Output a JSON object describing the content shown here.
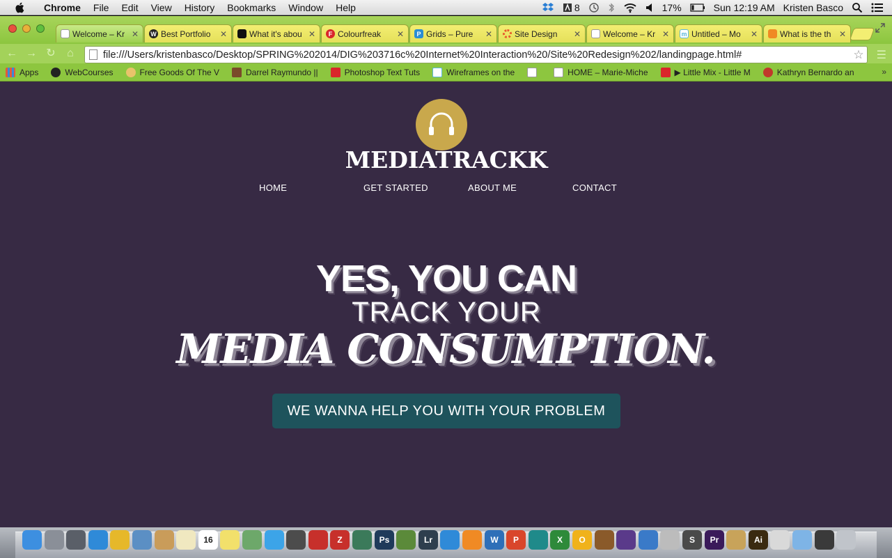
{
  "menubar": {
    "items": [
      "Chrome",
      "File",
      "Edit",
      "View",
      "History",
      "Bookmarks",
      "Window",
      "Help"
    ],
    "notification_count": "8",
    "battery": "17%",
    "clock": "Sun 12:19 AM",
    "user": "Kristen Basco"
  },
  "tabs": [
    {
      "title": "Welcome – Kr",
      "favicon": "page-icon",
      "color": "#ffffff"
    },
    {
      "title": "Best Portfolio",
      "favicon": "w-icon",
      "color": "#222222"
    },
    {
      "title": "What it's abou",
      "favicon": "film-icon",
      "color": "#111111"
    },
    {
      "title": "Colourfreak",
      "favicon": "f-icon",
      "color": "#d9262b"
    },
    {
      "title": "Grids – Pure",
      "favicon": "p-icon",
      "color": "#2a8dd4"
    },
    {
      "title": "Site Design",
      "favicon": "ring-icon",
      "color": "#e8582b"
    },
    {
      "title": "Welcome – Kr",
      "favicon": "page-icon",
      "color": "#ffffff"
    },
    {
      "title": "Untitled – Mo",
      "favicon": "m-icon",
      "color": "#5bb7db"
    },
    {
      "title": "What is the th",
      "favicon": "stack-icon",
      "color": "#f08a24"
    }
  ],
  "toolbar": {
    "url": "file:///Users/kristenbasco/Desktop/SPRING%202014/DIG%203716c%20Internet%20Interaction%20/Site%20Redesign%202/landingpage.html#"
  },
  "bookmarks": [
    {
      "label": "Apps",
      "color": "#e25b3a"
    },
    {
      "label": "WebCourses",
      "color": "#222222"
    },
    {
      "label": "Free Goods Of The V",
      "color": "#e9c36b"
    },
    {
      "label": "Darrel Raymundo ||",
      "color": "#7a4a2a"
    },
    {
      "label": "Photoshop Text Tuts",
      "color": "#d9262b"
    },
    {
      "label": "Wireframes on the",
      "color": "#5bb7db"
    },
    {
      "label": "",
      "color": "#ffffff"
    },
    {
      "label": "HOME – Marie-Miche",
      "color": "#ffffff"
    },
    {
      "label": "▶ Little Mix - Little M",
      "color": "#d9262b"
    },
    {
      "label": "Kathryn Bernardo an",
      "color": "#c0392b"
    }
  ],
  "page": {
    "logo": "MEDIATRACKK",
    "nav": [
      "HOME",
      "GET STARTED",
      "ABOUT ME",
      "CONTACT"
    ],
    "hero_line1": "YES, YOU CAN",
    "hero_line2": "TRACK YOUR",
    "hero_line3": "MEDIA CONSUMPTION.",
    "cta": "WE WANNA HELP YOU WITH YOUR PROBLEM",
    "colors": {
      "background": "#372a44",
      "accent": "#c9a84c",
      "button": "#1e535c"
    }
  },
  "dock": [
    {
      "icon": "finder-icon",
      "color": "#3d8fe0"
    },
    {
      "icon": "launchpad-icon",
      "color": "#8a8f98"
    },
    {
      "icon": "mission-control-icon",
      "color": "#5a5f68"
    },
    {
      "icon": "safari-icon",
      "color": "#2f8ad8"
    },
    {
      "icon": "chrome-icon",
      "color": "#e6b82a"
    },
    {
      "icon": "preview-icon",
      "color": "#5b8fc4"
    },
    {
      "icon": "contacts-icon",
      "color": "#c99c5a"
    },
    {
      "icon": "notes-icon",
      "color": "#f0e8c0"
    },
    {
      "icon": "calendar-icon",
      "color": "#ffffff",
      "label": "16"
    },
    {
      "icon": "stickies-icon",
      "color": "#f2e06b"
    },
    {
      "icon": "photos-icon",
      "color": "#6da86a"
    },
    {
      "icon": "messages-icon",
      "color": "#3ca4e8"
    },
    {
      "icon": "facetime-icon",
      "color": "#4c4c4c"
    },
    {
      "icon": "photo-booth-icon",
      "color": "#c7302b"
    },
    {
      "icon": "filezilla-icon",
      "color": "#c7302b",
      "label": "Z"
    },
    {
      "icon": "image-capture-icon",
      "color": "#3b7a5a"
    },
    {
      "icon": "photoshop-icon",
      "color": "#1f3a5a",
      "label": "Ps"
    },
    {
      "icon": "minecraft-icon",
      "color": "#5b8a3a"
    },
    {
      "icon": "lightroom-icon",
      "color": "#2e3e4e",
      "label": "Lr"
    },
    {
      "icon": "app-store-icon",
      "color": "#2f8ad8"
    },
    {
      "icon": "ibooks-icon",
      "color": "#f08a24"
    },
    {
      "icon": "word-icon",
      "color": "#2e6fb8",
      "label": "W"
    },
    {
      "icon": "powerpoint-icon",
      "color": "#d9462b",
      "label": "P"
    },
    {
      "icon": "maya-icon",
      "color": "#1f8a8a"
    },
    {
      "icon": "excel-icon",
      "color": "#2e8a3a",
      "label": "X"
    },
    {
      "icon": "outlook-icon",
      "color": "#f0b21b",
      "label": "O"
    },
    {
      "icon": "garageband-icon",
      "color": "#8a5a2a"
    },
    {
      "icon": "imovie-icon",
      "color": "#5a3a8a"
    },
    {
      "icon": "itunes-icon",
      "color": "#3a7ac8"
    },
    {
      "icon": "camera-icon",
      "color": "#bcbcbc"
    },
    {
      "icon": "sublime-icon",
      "color": "#4a4a4a",
      "label": "S"
    },
    {
      "icon": "premiere-icon",
      "color": "#3a1a5a",
      "label": "Pr"
    },
    {
      "icon": "image-icon",
      "color": "#c8a35a"
    },
    {
      "icon": "illustrator-icon",
      "color": "#3a2a10",
      "label": "Ai"
    },
    {
      "icon": "document-icon",
      "color": "#d9d9d9"
    },
    {
      "icon": "folder-icon",
      "color": "#7eb4e6"
    },
    {
      "icon": "screen-icon",
      "color": "#3a3a3a"
    },
    {
      "icon": "trash-icon",
      "color": "#c0c4ca"
    }
  ]
}
